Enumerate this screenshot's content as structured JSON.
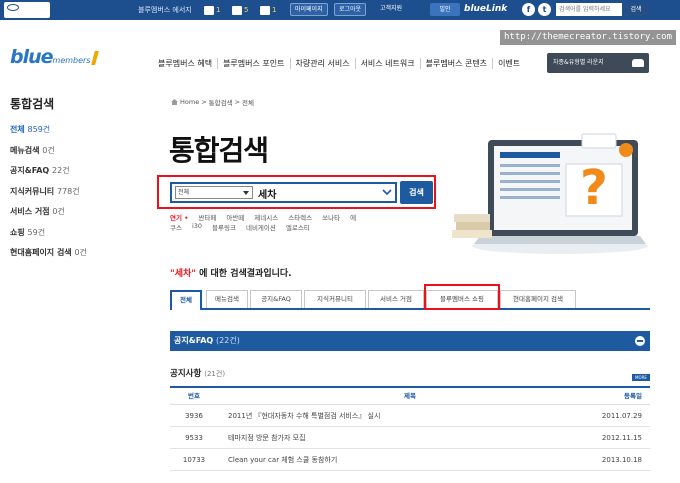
{
  "topbar": {
    "welcome": "블루멤버스 에서지",
    "stats": [
      "1",
      "5",
      "1"
    ],
    "buttons": [
      "마이페이지",
      "로그아웃",
      "고객지원"
    ],
    "bluelink_btn": "빌인",
    "bluelink_logo": "blueLink",
    "social": [
      "f",
      "t"
    ],
    "search_placeholder": "검색어를 입력하세요",
    "search_btn": "검색"
  },
  "watermark": "http://themecreator.tistory.com",
  "brand": {
    "main": "blue",
    "sub": "members"
  },
  "gnb": [
    "블루멤버스 혜택",
    "블루멤버스 포인트",
    "차량관리 서비스",
    "서비스 네트워크",
    "블루멤버스 콘텐츠",
    "이벤트"
  ],
  "car_button": "차종&유형별 라운지",
  "sidebar": {
    "title": "통합검색",
    "items": [
      {
        "label": "전체",
        "count": "859건",
        "active": true
      },
      {
        "label": "메뉴검색",
        "count": "0건"
      },
      {
        "label": "공지&FAQ",
        "count": "22건"
      },
      {
        "label": "지식커뮤니티",
        "count": "778건"
      },
      {
        "label": "서비스 거점",
        "count": "0건"
      },
      {
        "label": "쇼핑",
        "count": "59건"
      },
      {
        "label": "현대홈페이지 검색",
        "count": "0건"
      }
    ]
  },
  "breadcrumb": [
    "Home",
    ">",
    "통합검색",
    ">",
    "전체"
  ],
  "page_title": "통합검색",
  "search": {
    "scope": "전체",
    "query": "세차",
    "button": "검색",
    "keywords_row1": [
      "연기 •",
      "싼타페",
      "아반떼",
      "제네시스",
      "스타렉스",
      "쏘나타",
      "에"
    ],
    "keywords_row2": [
      "쿠스",
      "i30",
      "블루링크",
      "네비게이션",
      "엘로스티"
    ]
  },
  "results": {
    "query": "\"세차\"",
    "suffix": "에 대한 검색결과입니다."
  },
  "tabs": [
    "전체",
    "메뉴검색",
    "공지&FAQ",
    "지식커뮤니티",
    "서비스 거점",
    "블루멤버스 쇼핑",
    "현대홈페이지 검색"
  ],
  "faq_bar": {
    "label": "공지&FAQ",
    "count": "(22건)"
  },
  "notice": {
    "title": "공지사항",
    "count": "(21건)",
    "more": "MORE",
    "headers": {
      "no": "번호",
      "title": "제목",
      "date": "등록일"
    },
    "rows": [
      {
        "no": "3936",
        "title": "2011년 『현대자동차 수해 특별점검 서비스』 실시",
        "date": "2011.07.29"
      },
      {
        "no": "9533",
        "title": "테마지점 방문 참가자 모집",
        "date": "2012.11.15"
      },
      {
        "no": "10733",
        "title": "Clean your car 체험 스쿨 동참하기",
        "date": "2013.10.18"
      }
    ]
  },
  "colors": {
    "primary": "#1d5aa0",
    "topbar": "#1d4f8f",
    "highlight": "#e8141c"
  }
}
